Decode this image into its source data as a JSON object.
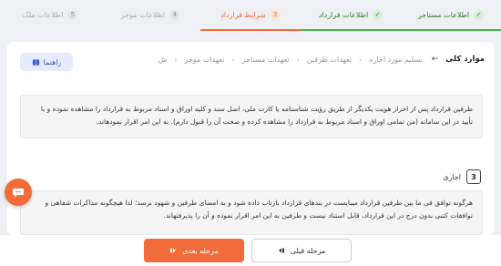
{
  "stepper": {
    "steps": [
      {
        "label": "اطلاعات مستاجر",
        "badge": "✓",
        "state": "done"
      },
      {
        "label": "اطلاعات قرارداد",
        "badge": "✓",
        "state": "done"
      },
      {
        "label": "شرایط قرارداد",
        "badge": "3",
        "state": "active"
      },
      {
        "label": "اطلاعات موجر",
        "badge": "4",
        "state": "pending"
      },
      {
        "label": "اطلاعات ملک",
        "badge": "5",
        "state": "pending"
      }
    ]
  },
  "breadcrumb": {
    "current": "موارد کلی",
    "items": [
      "تسلیم مورد اجاره",
      "تعهدات طرفین",
      "تعهدات مستاجر",
      "تعهدات موجر",
      "ش"
    ]
  },
  "help_button": {
    "label": "راهنما"
  },
  "notice": {
    "text": "طرفین قرارداد پس از احراز هویت یکدیگر از طریق رؤیت شناسنامه یا کارت ملی، اصل سند و کلیه اوراق و اسناد مربوط به قرارداد را مشاهده نموده و با تأیید در این سامانه (من تمامی اوراق و اسناد مربوط به قرارداد را مشاهده کرده و صحت آن را قبول دارم). به این امر اقرار نمودهاند."
  },
  "section": {
    "number": "3",
    "title": "اجاری",
    "body": "هرگونه توافق فی ما بین طرفین قرارداد میبایست در بندهای قرارداد بازتاب داده شود و به امضای طرفین و شهود برسد؛ لذا هیچگونه مذاکرات شفاهی و توافقات کتبی بدون درج در این قرارداد، قابل استناد نیست و طرفین به این امر اقرار نموده و آن را پذیرفتهاند."
  },
  "buttons": {
    "next": "مرحله بعدی",
    "prev": "مرحله قبلی"
  },
  "colors": {
    "accent": "#f26b3a",
    "done": "#4caf50",
    "help": "#3b5bd9"
  }
}
